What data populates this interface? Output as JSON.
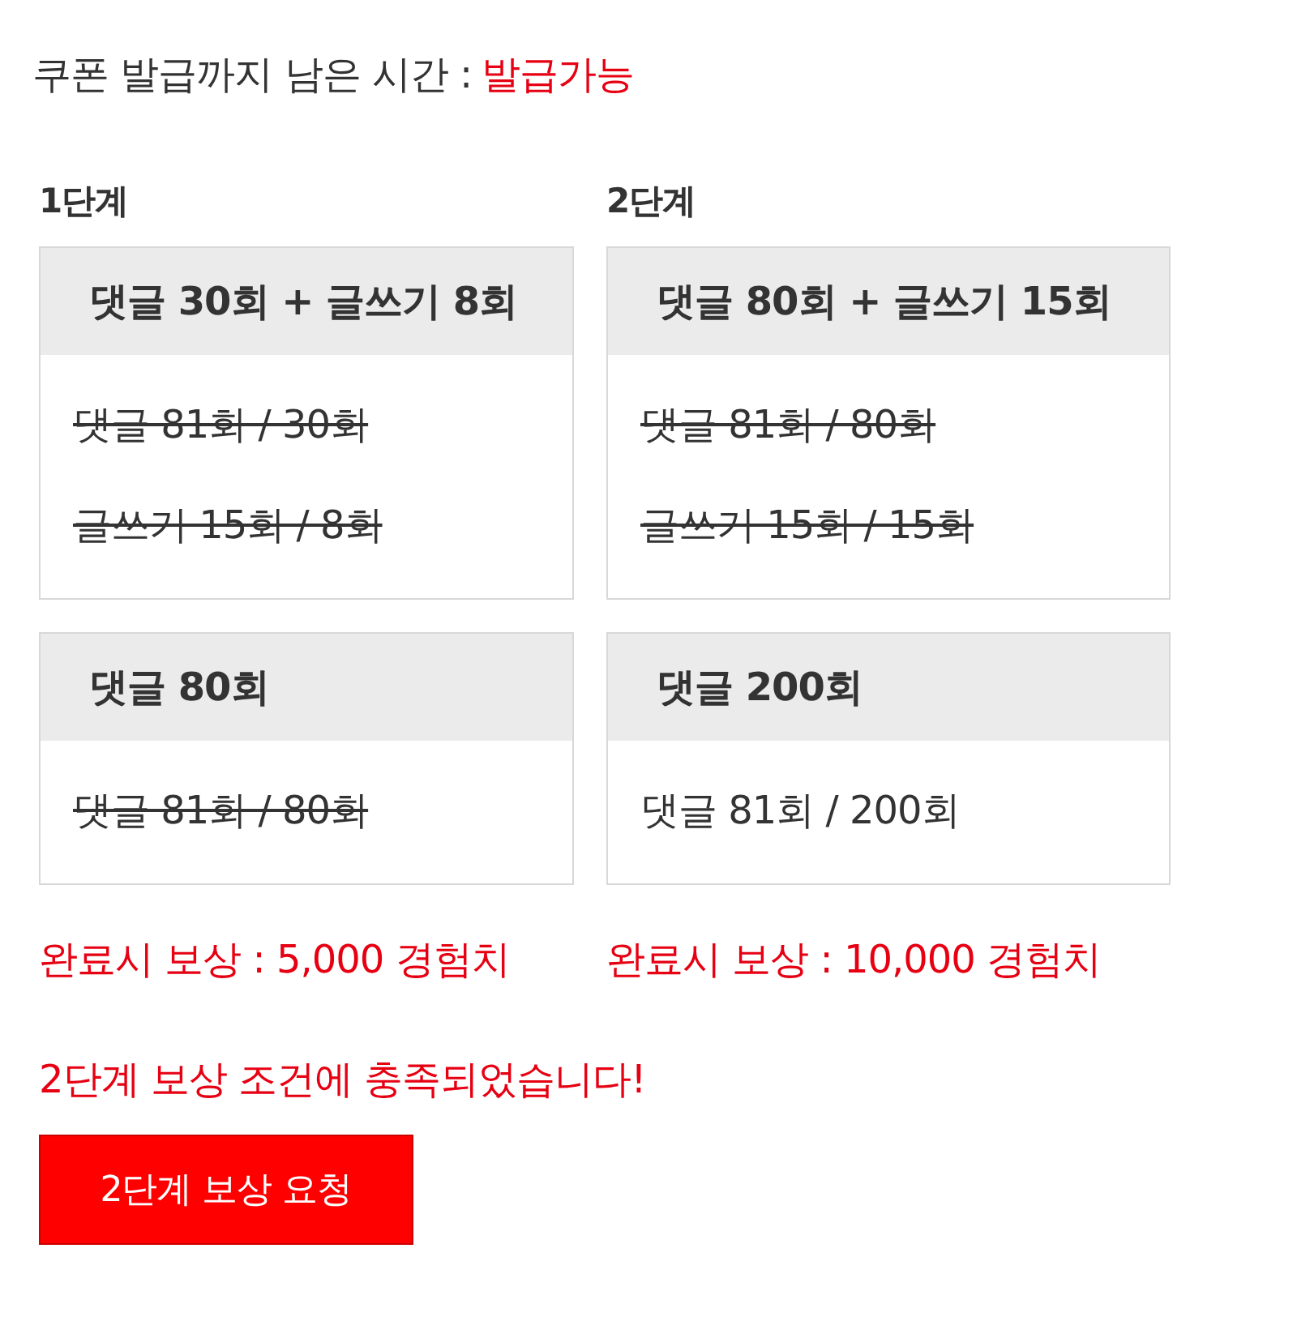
{
  "countdown": {
    "label": "쿠폰 발급까지 남은 시간 :",
    "value": "발급가능"
  },
  "stages": [
    {
      "label": "1단계",
      "groups": [
        {
          "title": "댓글 30회 + 글쓰기 8회",
          "items": [
            {
              "text": "댓글 81회 / 30회",
              "done": true
            },
            {
              "text": "글쓰기 15회 / 8회",
              "done": true
            }
          ]
        },
        {
          "title": "댓글 80회",
          "items": [
            {
              "text": "댓글 81회 / 80회",
              "done": true
            }
          ]
        }
      ],
      "reward": "완료시 보상 : 5,000 경험치"
    },
    {
      "label": "2단계",
      "groups": [
        {
          "title": "댓글 80회 + 글쓰기 15회",
          "items": [
            {
              "text": "댓글 81회 / 80회",
              "done": true
            },
            {
              "text": "글쓰기 15회 / 15회",
              "done": true
            }
          ]
        },
        {
          "title": "댓글 200회",
          "items": [
            {
              "text": "댓글 81회 / 200회",
              "done": false
            }
          ]
        }
      ],
      "reward": "완료시 보상 : 10,000 경험치"
    }
  ],
  "message": "2단계 보상 조건에 충족되었습니다!",
  "button": "2단계 보상 요청"
}
